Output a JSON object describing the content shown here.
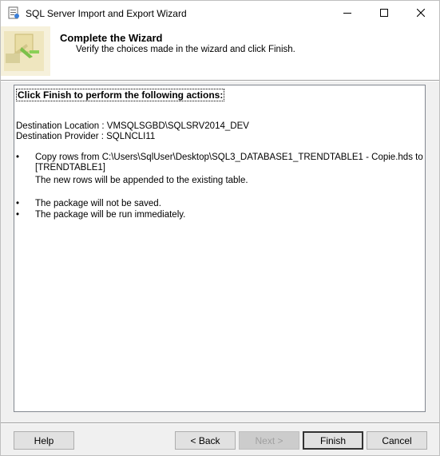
{
  "window": {
    "title": "SQL Server Import and Export Wizard"
  },
  "header": {
    "title": "Complete the Wizard",
    "subtitle": "Verify the choices made in the wizard and click Finish."
  },
  "content": {
    "heading": "Click Finish to perform the following actions:",
    "destination_location": "Destination Location : VMSQLSGBD\\SQLSRV2014_DEV",
    "destination_provider": "Destination Provider : SQLNCLI11",
    "actions": [
      {
        "bullet": "•",
        "line1": "Copy rows from C:\\Users\\SqlUser\\Desktop\\SQL3_DATABASE1_TRENDTABLE1 - Copie.hds to [dbo].",
        "line2": "[TRENDTABLE1]",
        "line3": "The new rows will be appended to the existing table."
      },
      {
        "bullet": "•",
        "line1": "The package will not be saved."
      },
      {
        "bullet": "•",
        "line1": "The package will be run immediately."
      }
    ]
  },
  "buttons": {
    "help": "Help",
    "back": "< Back",
    "next": "Next >",
    "finish": "Finish",
    "cancel": "Cancel"
  },
  "icons": {
    "app": "wizard-app-icon",
    "minimize": "minimize-icon",
    "maximize": "maximize-icon",
    "close": "close-icon",
    "header_graphic": "wizard-header-graphic"
  }
}
